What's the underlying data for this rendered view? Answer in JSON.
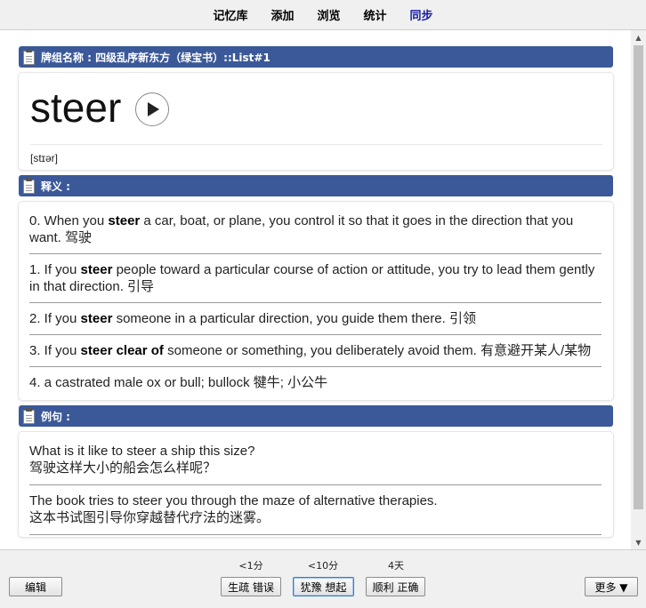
{
  "nav": {
    "items": [
      "记忆库",
      "添加",
      "浏览",
      "统计",
      "同步"
    ]
  },
  "deck": {
    "header": "牌组名称 : 四级乱序新东方（绿宝书）::List#1"
  },
  "word": {
    "text": "steer",
    "phonetic": "[stɪər]"
  },
  "definitions": {
    "header": "释义 :",
    "items": [
      {
        "pre": "0. When you ",
        "bold": "steer",
        "post": " a car, boat, or plane, you control it so that it goes in the direction that you want. 驾驶"
      },
      {
        "pre": "1. If you ",
        "bold": "steer",
        "post": " people toward a particular course of action or attitude, you try to lead them gently in that direction. 引导"
      },
      {
        "pre": "2. If you ",
        "bold": "steer",
        "post": " someone in a particular direction, you guide them there. 引领"
      },
      {
        "pre": "3. If you ",
        "bold": "steer clear of",
        "post": " someone or something, you deliberately avoid them. 有意避开某人/某物"
      },
      {
        "pre": "4. a castrated male ox or bull; bullock 犍牛; 小公牛",
        "bold": "",
        "post": ""
      }
    ]
  },
  "examples": {
    "header": "例句 :",
    "items": [
      {
        "en": "What is it like to steer a ship this size?",
        "zh": "驾驶这样大小的船会怎么样呢？"
      },
      {
        "en": "The book tries to steer you through the maze of alternative therapies.",
        "zh": "这本书试图引导你穿越替代疗法的迷雾。"
      }
    ]
  },
  "footer": {
    "edit_label": "编辑",
    "more_label": "更多 ▼",
    "answers": [
      {
        "interval": "<1分",
        "label": "生疏 错误"
      },
      {
        "interval": "<10分",
        "label": "犹豫 想起"
      },
      {
        "interval": "4天",
        "label": "顺利 正确"
      }
    ]
  },
  "colors": {
    "header_bg": "#3b5999",
    "sync_link": "#1a1aa6"
  },
  "icons": {
    "section": "clipboard-icon",
    "audio": "play-icon"
  }
}
